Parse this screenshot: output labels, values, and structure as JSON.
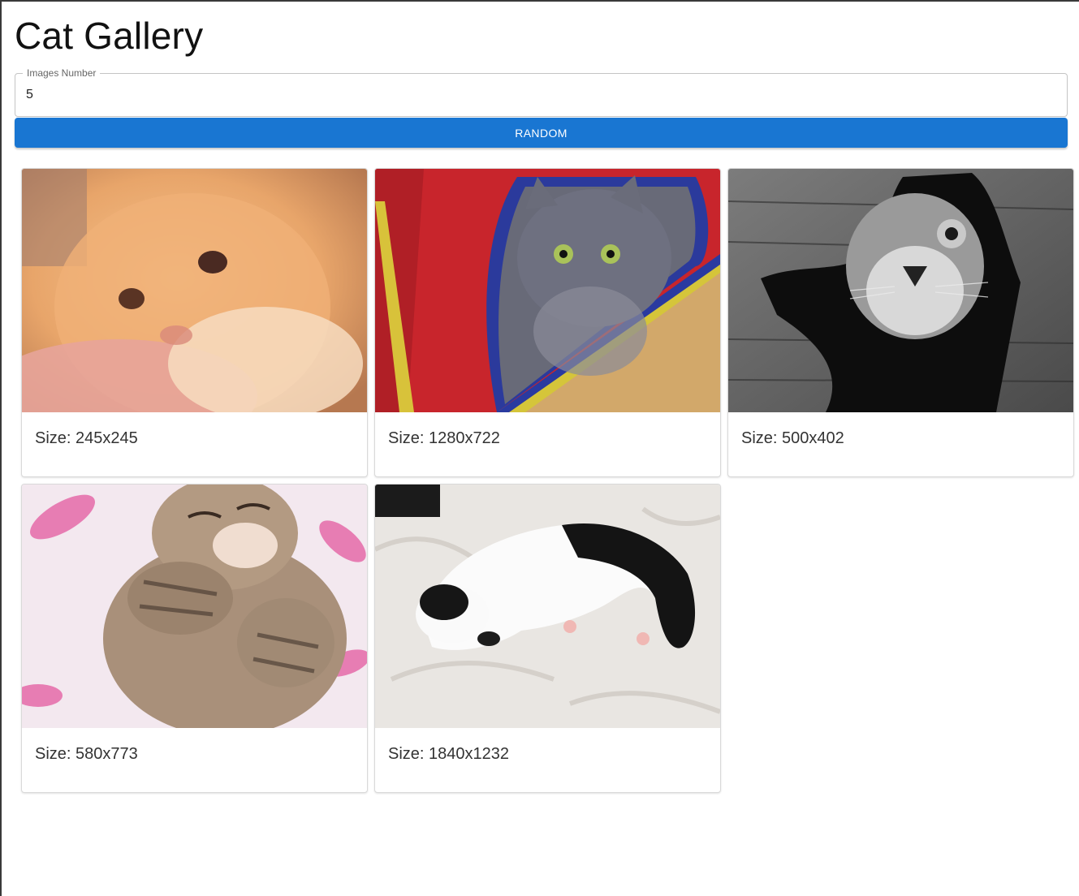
{
  "page": {
    "title": "Cat Gallery"
  },
  "controls": {
    "images_number": {
      "label": "Images Number",
      "value": "5"
    },
    "random_button": {
      "label": "RANDOM"
    }
  },
  "gallery": {
    "items": [
      {
        "image": "orange-kitten-photo",
        "caption": "Size: 245x245"
      },
      {
        "image": "gray-cat-in-tent-photo",
        "caption": "Size: 1280x722"
      },
      {
        "image": "bw-cat-in-wall-hole-photo",
        "caption": "Size: 500x402"
      },
      {
        "image": "sleeping-tabby-kitten-photo",
        "caption": "Size: 580x773"
      },
      {
        "image": "black-white-cat-on-sheets-photo",
        "caption": "Size: 1840x1232"
      }
    ]
  }
}
